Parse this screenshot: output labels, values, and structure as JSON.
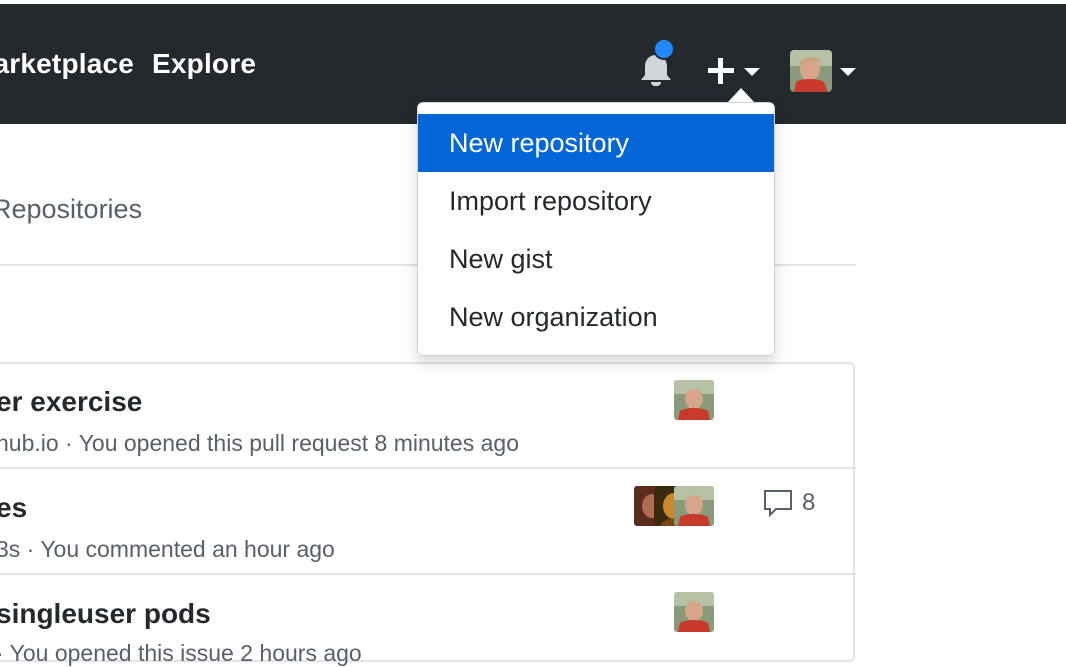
{
  "header": {
    "nav": [
      {
        "label": "Marketplace"
      },
      {
        "label": "Explore"
      }
    ],
    "notifications_icon": "bell-icon",
    "unread_indicator_color": "#2188ff",
    "create_icon": "plus-icon",
    "avatar_icon": "user-avatar"
  },
  "subnav": {
    "text": "Repositories"
  },
  "dropdown": {
    "items": [
      {
        "label": "New repository",
        "active": true
      },
      {
        "label": "Import repository"
      },
      {
        "label": "New gist"
      },
      {
        "label": "New organization"
      }
    ]
  },
  "list": {
    "rows": [
      {
        "title": "er exercise",
        "meta": "hub.io · You opened this pull request 8 minutes ago"
      },
      {
        "title": "es",
        "meta": "3s · You commented an hour ago",
        "comments": "8"
      },
      {
        "title": "singleuser pods",
        "meta": "· You opened this issue 2 hours ago"
      }
    ]
  },
  "colors": {
    "header_bg": "#24292e",
    "accent": "#0366d6",
    "muted_text": "#586069"
  }
}
